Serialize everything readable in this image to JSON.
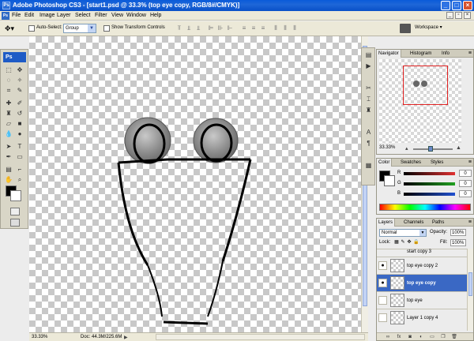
{
  "window": {
    "title": "Adobe Photoshop CS3 - [start1.psd @ 33.3% (top eye copy, RGB/8#/CMYK)]"
  },
  "menu": [
    "File",
    "Edit",
    "Image",
    "Layer",
    "Select",
    "Filter",
    "View",
    "Window",
    "Help"
  ],
  "options": {
    "auto_select_label": "Auto-Select:",
    "auto_select_value": "Group",
    "show_transform_label": "Show Transform Controls",
    "workspace_label": "Workspace ▾"
  },
  "tools_badge": "Ps",
  "navigator": {
    "tabs": [
      "Navigator",
      "Histogram",
      "Info"
    ],
    "zoom": "33.33%"
  },
  "color": {
    "tabs": [
      "Color",
      "Swatches",
      "Styles"
    ],
    "channels": [
      {
        "label": "R",
        "value": "0"
      },
      {
        "label": "G",
        "value": "0"
      },
      {
        "label": "B",
        "value": "0"
      }
    ],
    "bar_colors": [
      "#e03030",
      "#20a020",
      "#2050d0"
    ]
  },
  "layers": {
    "tabs": [
      "Layers",
      "Channels",
      "Paths"
    ],
    "blend_mode": "Normal",
    "opacity_label": "Opacity:",
    "opacity": "100%",
    "lock_label": "Lock:",
    "fill_label": "Fill:",
    "fill": "100%",
    "items": [
      {
        "name": "start copy 3",
        "visible": false,
        "active": false
      },
      {
        "name": "top eye copy 2",
        "visible": true,
        "active": false
      },
      {
        "name": "top eye copy",
        "visible": true,
        "active": true
      },
      {
        "name": "top eye",
        "visible": false,
        "active": false
      },
      {
        "name": "Layer 1 copy 4",
        "visible": false,
        "active": false
      }
    ]
  },
  "status": {
    "zoom": "33.33%",
    "doc": "Doc: 44.3M/225.6M"
  }
}
